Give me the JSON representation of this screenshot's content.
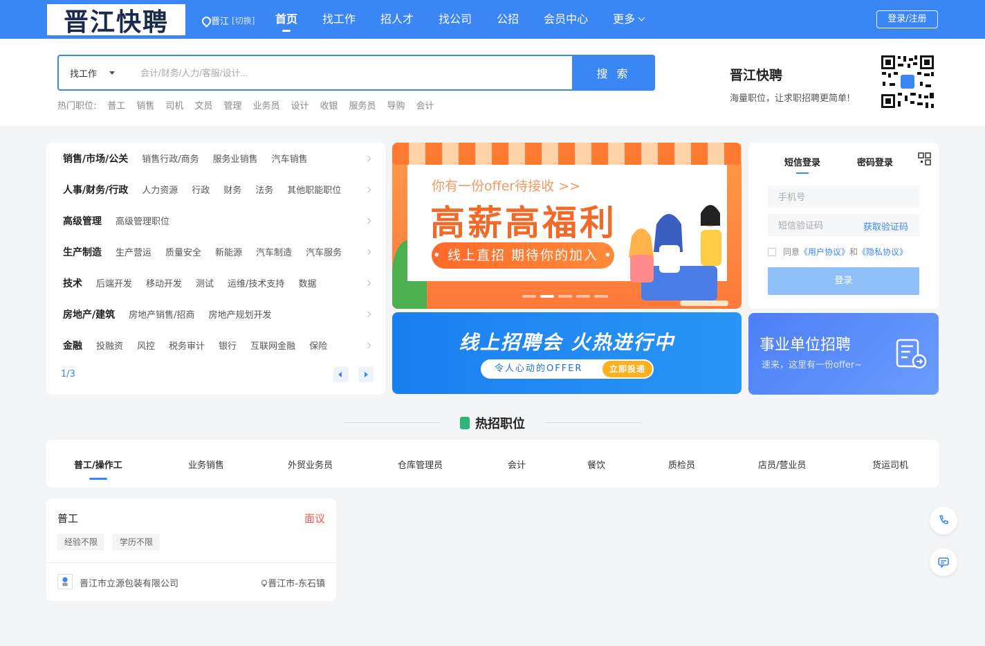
{
  "nav": {
    "logo_text": "晋江快聘",
    "location": "晋江",
    "location_switch": "[切换]",
    "items": [
      {
        "label": "首页",
        "active": true
      },
      {
        "label": "找工作",
        "active": false
      },
      {
        "label": "招人才",
        "active": false
      },
      {
        "label": "找公司",
        "active": false
      },
      {
        "label": "公招",
        "active": false
      },
      {
        "label": "会员中心",
        "active": false
      },
      {
        "label": "更多",
        "active": false
      }
    ],
    "login_label": "登录/注册"
  },
  "search": {
    "type": "找工作",
    "placeholder": "会计/财务/人力/客服/设计...",
    "button": "搜 索",
    "hot_label": "热门职位:",
    "hot_jobs": [
      "普工",
      "销售",
      "司机",
      "文员",
      "管理",
      "业务员",
      "设计",
      "收银",
      "服务员",
      "导购",
      "会计"
    ]
  },
  "brand": {
    "title": "晋江快聘",
    "slogan": "海量职位，让求职招聘更简单!"
  },
  "categories": [
    {
      "main": "销售/市场/公关",
      "subs": [
        "销售行政/商务",
        "服务业销售",
        "汽车销售"
      ]
    },
    {
      "main": "人事/财务/行政",
      "subs": [
        "人力资源",
        "行政",
        "财务",
        "法务",
        "其他职能职位"
      ]
    },
    {
      "main": "高级管理",
      "subs": [
        "高级管理职位"
      ]
    },
    {
      "main": "生产制造",
      "subs": [
        "生产营运",
        "质量安全",
        "新能源",
        "汽车制造",
        "汽车服务"
      ]
    },
    {
      "main": "技术",
      "subs": [
        "后端开发",
        "移动开发",
        "测试",
        "运维/技术支持",
        "数据"
      ]
    },
    {
      "main": "房地产/建筑",
      "subs": [
        "房地产销售/招商",
        "房地产规划开发"
      ]
    },
    {
      "main": "金融",
      "subs": [
        "投融资",
        "风控",
        "税务审计",
        "银行",
        "互联网金融",
        "保险"
      ]
    }
  ],
  "category_page": "1/3",
  "banner1": {
    "line1": "你有一份offer待接收 >>",
    "line2": "高薪高福利",
    "pill": "• 线上直招 期待你的加入 •"
  },
  "banner2": {
    "line1": "线上招聘会 火热进行中",
    "pill": "令人心动的OFFER",
    "go": "立即投递"
  },
  "banner3": {
    "line1": "事业单位招聘",
    "line2": "速来，这里有一份offer~"
  },
  "login": {
    "tab_sms": "短信登录",
    "tab_password": "密码登录",
    "phone_placeholder": "手机号",
    "code_placeholder": "短信验证码",
    "get_code": "获取验证码",
    "agree_prefix": "同意",
    "user_agreement": "《用户协议》",
    "and": "和",
    "privacy": "《隐私协议》",
    "submit": "登录"
  },
  "hot": {
    "title": "热招职位",
    "tabs": [
      "普工/操作工",
      "业务销售",
      "外贸业务员",
      "仓库管理员",
      "会计",
      "餐饮",
      "质检员",
      "店员/营业员",
      "货运司机"
    ]
  },
  "job": {
    "title": "普工",
    "salary": "面议",
    "tags": [
      "经验不限",
      "学历不限"
    ],
    "company": "晋江市立源包装有限公司",
    "location": "晋江市-东石镇"
  },
  "colors": {
    "primary": "#3b86f5",
    "salary": "#f5544d",
    "banner_orange": "#fe7a3a"
  }
}
